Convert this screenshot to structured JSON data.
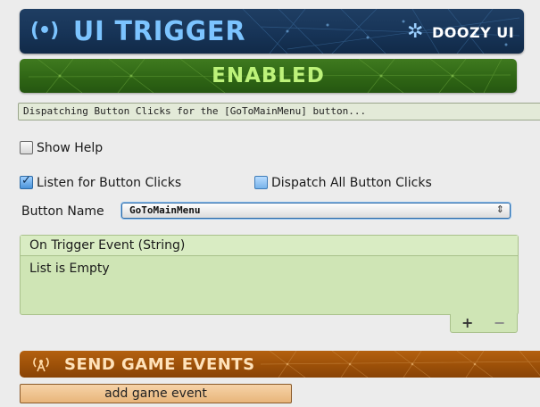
{
  "header": {
    "icon": "(•)",
    "icon_name": "broadcast-icon",
    "title": "UI TRIGGER",
    "brand_icon": "✲",
    "brand": "DOOZY UI"
  },
  "state": {
    "label": "ENABLED"
  },
  "status": {
    "text": "Dispatching Button Clicks for the [GoToMainMenu] button..."
  },
  "options": {
    "show_help": {
      "label": "Show Help",
      "checked": false
    },
    "listen_clicks": {
      "label": "Listen for Button Clicks",
      "checked": true
    },
    "dispatch_all": {
      "label": "Dispatch All Button Clicks",
      "checked": false
    }
  },
  "button_name": {
    "label": "Button Name",
    "value": "GoToMainMenu",
    "arrows": "⇕"
  },
  "event_panel": {
    "title": "On Trigger Event (String)",
    "empty_text": "List is Empty",
    "add": "+",
    "remove": "−"
  },
  "game_events": {
    "icon": "📡",
    "title": "SEND GAME EVENTS",
    "add_button": "add game event"
  },
  "colors": {
    "header_bg": "#173457",
    "header_text": "#7cc4ff",
    "enabled_bg": "#2e6414",
    "enabled_text": "#bdf27a",
    "game_events_bg": "#9a4f08",
    "panel_bg": "#cfe5b5"
  }
}
